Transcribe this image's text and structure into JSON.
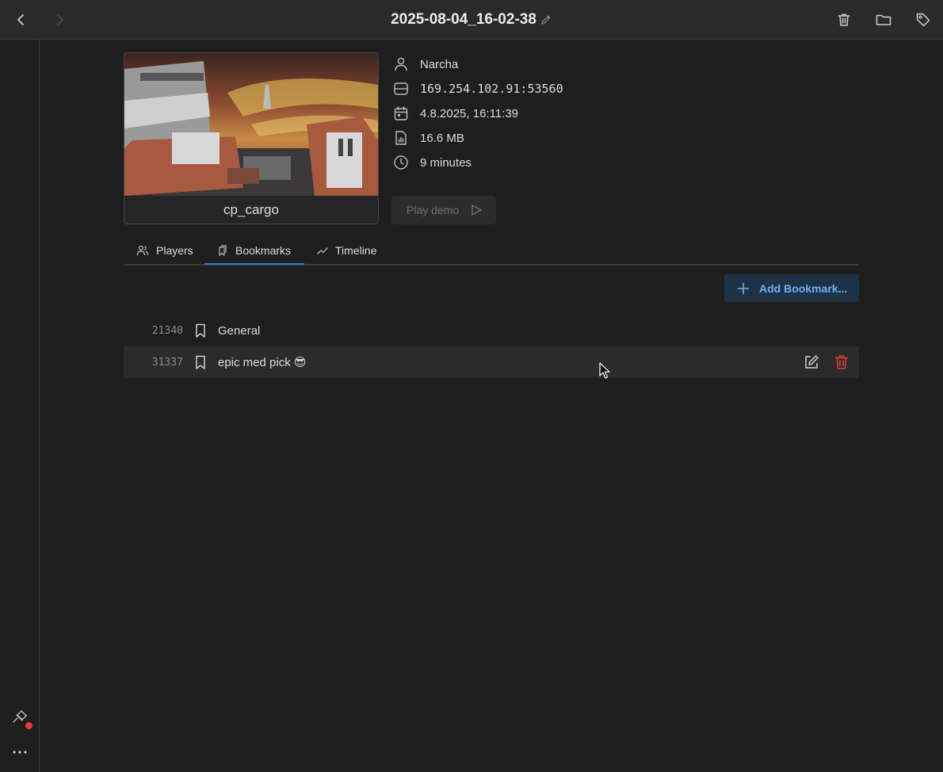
{
  "header": {
    "title": "2025-08-04_16-02-38",
    "icons": [
      "back-icon",
      "forward-icon",
      "pencil-icon",
      "trash-icon",
      "folder-icon",
      "tag-icon"
    ]
  },
  "map": {
    "name": "cp_cargo"
  },
  "info": {
    "player": "Narcha",
    "server": "169.254.102.91:53560",
    "date": "4.8.2025, 16:11:39",
    "size": "16.6 MB",
    "duration": "9 minutes"
  },
  "play_button": {
    "label": "Play demo"
  },
  "tabs": [
    {
      "label": "Players",
      "icon": "users-icon",
      "active": false
    },
    {
      "label": "Bookmarks",
      "icon": "bookmarks-icon",
      "active": true
    },
    {
      "label": "Timeline",
      "icon": "chart-line-icon",
      "active": false
    }
  ],
  "add_bookmark": {
    "label": "Add Bookmark..."
  },
  "bookmarks": [
    {
      "tick": "21340",
      "name": "General"
    },
    {
      "tick": "31337",
      "name": "epic med pick 😎"
    }
  ],
  "colors": {
    "accent": "#2f7fd8",
    "add_text": "#6ab2f2",
    "danger": "#e23a3a",
    "background": "#1e1e1e"
  }
}
